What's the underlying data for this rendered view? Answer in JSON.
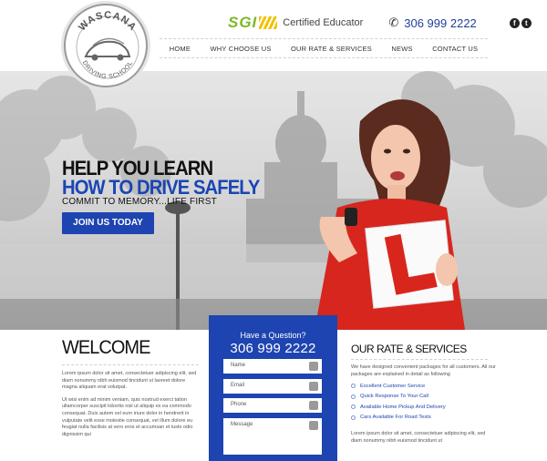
{
  "brand": {
    "logo_top": "WASCANA",
    "logo_bottom": "DRIVING SCHOOL"
  },
  "topbar": {
    "sgi": "SGI",
    "certified": "Certified Educator",
    "phone": "306 999 2222",
    "social": [
      "facebook-icon",
      "twitter-icon"
    ]
  },
  "nav": {
    "items": [
      "HOME",
      "WHY CHOOSE US",
      "OUR RATE & SERVICES",
      "NEWS",
      "CONTACT US"
    ]
  },
  "hero": {
    "line1": "HELP YOU LEARN",
    "line2": "HOW TO DRIVE SAFELY",
    "tagline": "COMMIT TO MEMORY...LIFE FIRST",
    "cta": "JOIN US TODAY",
    "l_plate": "L"
  },
  "welcome": {
    "title": "WELCOME",
    "p1": "Lorem ipsum dolor sit amet, consectetuer adipiscing elit, sed diam nonummy nibh euismod tincidunt ut laoreet dolore magna aliquam erat volutpat.",
    "p2": "Ut wisi enim ad minim veniam, quis nostrud exerci tation ullamcorper suscipit lobortis nisl ut aliquip ex ea commodo consequat. Duis autem vel eum iriure dolor in hendrerit in vulputate velit esse molestie consequat, vel illum dolore eu feugiat nulla facilisis at vero eros et accumsan et iusto odio dignissim qui"
  },
  "question": {
    "heading": "Have a Question?",
    "phone": "306 999 2222",
    "fields": [
      {
        "placeholder": "Name",
        "icon": "user-icon"
      },
      {
        "placeholder": "Email",
        "icon": "envelope-icon"
      },
      {
        "placeholder": "Phone",
        "icon": "phone-icon"
      },
      {
        "placeholder": "Message",
        "icon": "pencil-icon"
      }
    ]
  },
  "rates": {
    "title": "OUR RATE & SERVICES",
    "intro": "We have designed convenient packages for all customers. All our packages are explained in detail as following",
    "items": [
      "Excellent Customer Service",
      "Quick Response To Your Call",
      "Available Home Pickup And Delivery",
      "Cars Available For Road Tests"
    ],
    "p2": "Lorem ipsum dolor sit amet, consectetuer adipiscing elit, sed diam nonummy nibh euismod tincidunt ut"
  },
  "colors": {
    "accent": "#1d44b0",
    "sgi_green": "#7ab929",
    "plate_red": "#d9261c"
  }
}
